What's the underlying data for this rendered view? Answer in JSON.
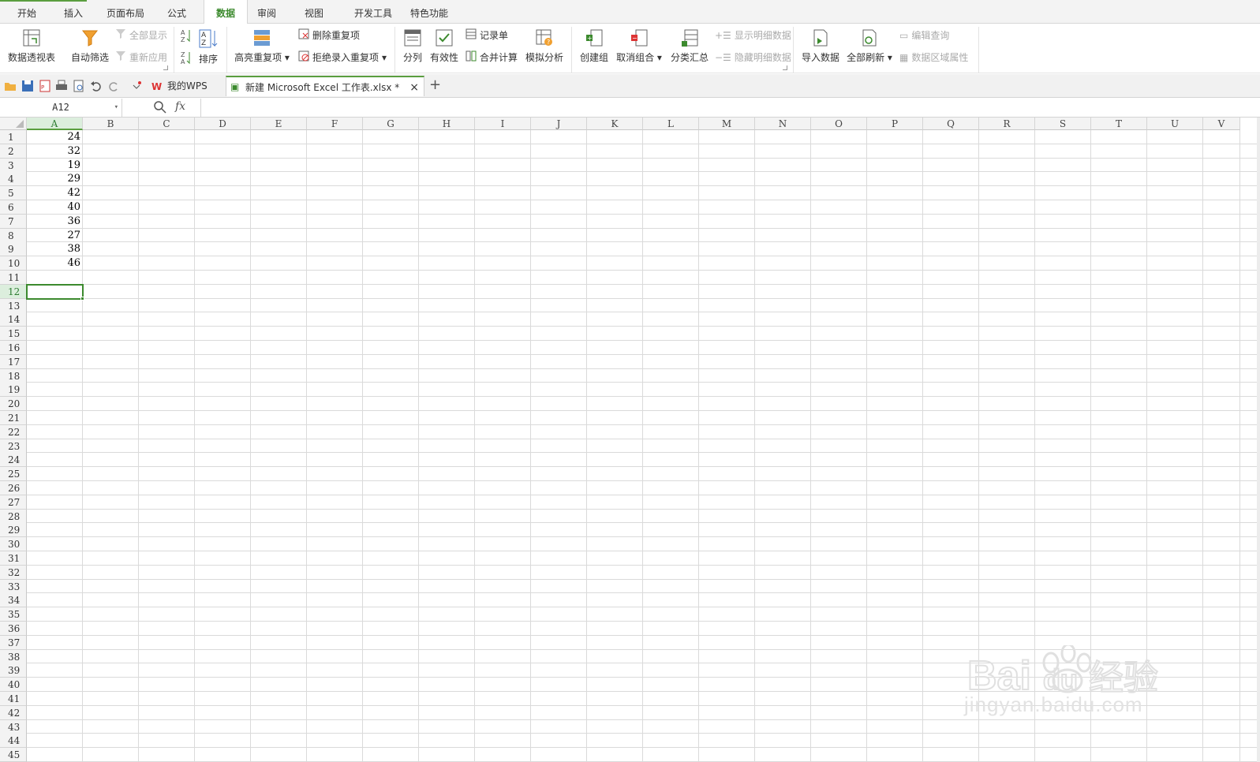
{
  "ribbon_tabs": [
    "开始",
    "插入",
    "页面布局",
    "公式",
    "数据",
    "审阅",
    "视图",
    "开发工具",
    "特色功能"
  ],
  "active_tab": "数据",
  "ribbon": {
    "pivot": "数据透视表",
    "autofilter": "自动筛选",
    "show_all": "全部显示",
    "reapply": "重新应用",
    "sort": "排序",
    "highlight_dup": "高亮重复项",
    "remove_dup": "删除重复项",
    "reject_dup": "拒绝录入重复项",
    "text_to_cols": "分列",
    "validity": "有效性",
    "record_form": "记录单",
    "consolidate": "合并计算",
    "what_if": "模拟分析",
    "group": "创建组",
    "ungroup": "取消组合",
    "subtotal": "分类汇总",
    "show_detail": "显示明细数据",
    "hide_detail": "隐藏明细数据",
    "import_data": "导入数据",
    "refresh_all": "全部刷新",
    "edit_query": "编辑查询",
    "range_props": "数据区域属性"
  },
  "doc_tabs": {
    "wps": "我的WPS",
    "file": "新建 Microsoft Excel 工作表.xlsx *",
    "close": "×",
    "add": "+"
  },
  "formula_bar": {
    "name_box": "A12",
    "fx": "fx",
    "content": ""
  },
  "columns": [
    "A",
    "B",
    "C",
    "D",
    "E",
    "F",
    "G",
    "H",
    "I",
    "J",
    "K",
    "L",
    "M",
    "N",
    "O",
    "P",
    "Q",
    "R",
    "S",
    "T",
    "U",
    "V"
  ],
  "row_count": 45,
  "selected_cell": "A12",
  "cells_A": [
    24,
    32,
    19,
    29,
    42,
    40,
    36,
    27,
    38,
    46
  ],
  "watermark": {
    "text": "jingyan.baidu.com",
    "brand": "Bai du 经验"
  },
  "colors": {
    "accent": "#3c8a2e",
    "header_bg": "#f3f3f3",
    "grid": "#dadada"
  }
}
